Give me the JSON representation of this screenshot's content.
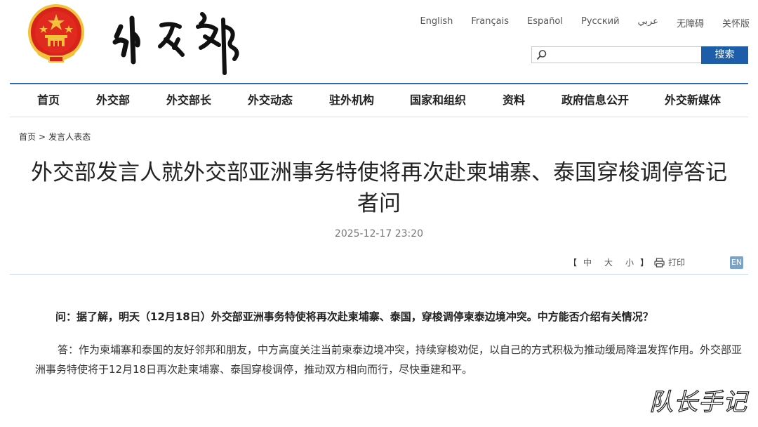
{
  "header": {
    "emblem_alt": "national-emblem",
    "logo_calligraphy": "外交部",
    "languages": [
      "English",
      "Français",
      "Español",
      "Русский",
      "عربي",
      "无障碍",
      "关怀版"
    ],
    "search": {
      "placeholder": "",
      "button_label": "搜索"
    }
  },
  "nav": {
    "items": [
      "首页",
      "外交部",
      "外交部长",
      "外交动态",
      "驻外机构",
      "国家和组织",
      "资料",
      "政府信息公开",
      "外交新媒体"
    ]
  },
  "breadcrumb": {
    "home": "首页",
    "separator": ">",
    "section": "发言人表态"
  },
  "article": {
    "title": "外交部发言人就外交部亚洲事务特使将再次赴柬埔寨、泰国穿梭调停答记者问",
    "date": "2025-12-17 23:20",
    "font_size": {
      "open": "【",
      "large": "中",
      "medium": "大",
      "small": "小",
      "close": "】"
    },
    "print_label": "打印",
    "en_label": "EN",
    "question": "问：据了解，明天（12月18日）外交部亚洲事务特使将再次赴柬埔寨、泰国，穿梭调停柬泰边境冲突。中方能否介绍有关情况？",
    "answer": "答：作为柬埔寨和泰国的友好邻邦和朋友，中方高度关注当前柬泰边境冲突，持续穿梭劝促，以自己的方式积极为推动缓局降温发挥作用。外交部亚洲事务特使将于12月18日再次赴柬埔寨、泰国穿梭调停，推动双方相向而行，尽快重建和平。"
  },
  "watermark": "队长手记",
  "colors": {
    "nav_line": "#2c6db0",
    "search_button": "#1e5ea8",
    "emblem_red": "#d8231a",
    "emblem_gold": "#f2c23a"
  }
}
